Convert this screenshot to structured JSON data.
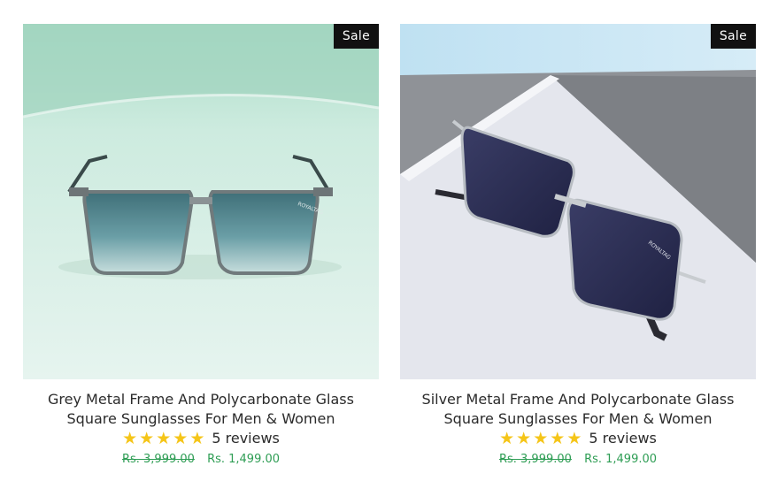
{
  "colors": {
    "star": "#f5c518",
    "price": "#2e9d54",
    "badge_bg": "#111111",
    "badge_text": "#ffffff"
  },
  "products": [
    {
      "badge": "Sale",
      "title_line1": "Grey Metal Frame And Polycarbonate Glass",
      "title_line2": "Square Sunglasses For Men & Women",
      "rating": 5,
      "reviews": "5 reviews",
      "compare_price": "Rs. 3,999.00",
      "price": "Rs. 1,499.00",
      "brand_mark": "ROYALTAG"
    },
    {
      "badge": "Sale",
      "title_line1": "Silver Metal Frame And Polycarbonate Glass",
      "title_line2": "Square Sunglasses For Men & Women",
      "rating": 5,
      "reviews": "5 reviews",
      "compare_price": "Rs. 3,999.00",
      "price": "Rs. 1,499.00",
      "brand_mark": "ROYALTAG"
    }
  ]
}
